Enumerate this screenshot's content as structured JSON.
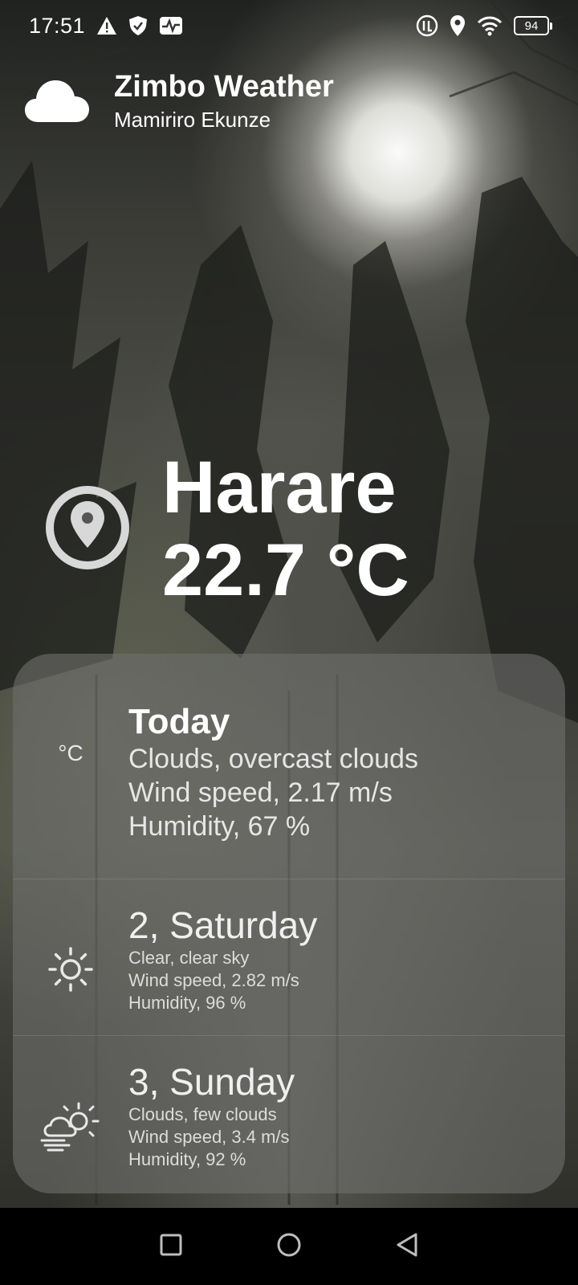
{
  "status_bar": {
    "time": "17:51",
    "battery": "94",
    "left_icons": [
      "warning-icon",
      "shield-icon",
      "activity-icon"
    ],
    "right_icons": [
      "data-icon",
      "location-icon",
      "wifi-icon",
      "battery-icon"
    ]
  },
  "header": {
    "title": "Zimbo Weather",
    "subtitle": "Mamiriro Ekunze",
    "icon": "cloud-icon"
  },
  "location": {
    "city": "Harare",
    "temperature": "22.7 °C",
    "icon": "location-pin-icon"
  },
  "forecast": {
    "today": {
      "title": "Today",
      "icon_text": "°C",
      "condition": "Clouds, overcast clouds",
      "wind": "Wind speed, 2.17 m/s",
      "humidity": "Humidity, 67 %"
    },
    "days": [
      {
        "title": "2, Saturday",
        "icon": "sun-icon",
        "condition": "Clear, clear sky",
        "wind": "Wind speed, 2.82 m/s",
        "humidity": "Humidity, 96 %"
      },
      {
        "title": "3, Sunday",
        "icon": "partly-cloudy-windy-icon",
        "condition": "Clouds, few clouds",
        "wind": "Wind speed, 3.4 m/s",
        "humidity": "Humidity, 92 %"
      }
    ]
  },
  "nav_bar": {
    "buttons": [
      "recents-button",
      "home-button",
      "back-button"
    ]
  },
  "colors": {
    "card_background": "#6e6e6c",
    "nav_background": "#000000",
    "text": "#ffffff"
  }
}
